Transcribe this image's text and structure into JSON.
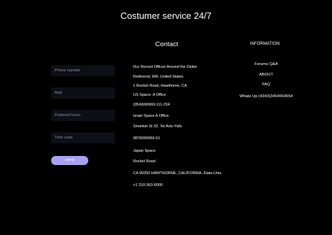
{
  "page": {
    "title": "Costumer service 24/7"
  },
  "contact": {
    "heading": "Contact",
    "form": {
      "phone_placeholder": "Phone number",
      "mail_placeholder": "Mail",
      "hours_placeholder": "Prefered hours",
      "timezone_placeholder": "Time zone",
      "send_label": "send"
    },
    "addresses": [
      "Our Recruit Offices Around the Globe",
      "Redmond, WA, United States",
      "1 Rocket Road, Hawthorne, CA",
      "US Space- A Office",
      "(954)696969-111-234",
      "Israel Space A Office",
      "Sheinkin St 32, Tel Aviv-Yafo",
      "0876696969-01",
      "Japan Space",
      "Rocket Road",
      "CA 90250 HAWTHORNE, CALIFORNIA, États-Unis",
      "+1 310-363-6000"
    ]
  },
  "information": {
    "heading": "INFORMATION",
    "links": [
      "Forums Q&A",
      "ABOUT",
      "FAQ",
      "Whats Up (4343)3454654654"
    ]
  },
  "colors": {
    "background": "#000000",
    "field": "#0e0e16",
    "button": "#a8a2f0"
  }
}
